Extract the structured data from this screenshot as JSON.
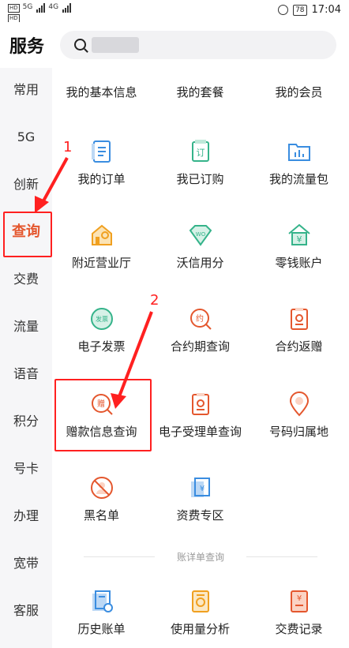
{
  "status_bar": {
    "left_badge_1": "HD",
    "left_badge_2": "HD",
    "net_1": "5G",
    "net_2": "4G",
    "battery": "78",
    "time": "17:04"
  },
  "header": {
    "title": "服务"
  },
  "sidebar": {
    "items": [
      {
        "label": "常用"
      },
      {
        "label": "5G"
      },
      {
        "label": "创新"
      },
      {
        "label": "查询"
      },
      {
        "label": "交费"
      },
      {
        "label": "流量"
      },
      {
        "label": "语音"
      },
      {
        "label": "积分"
      },
      {
        "label": "号卡"
      },
      {
        "label": "办理"
      },
      {
        "label": "宽带"
      },
      {
        "label": "客服"
      }
    ],
    "active_index": 3
  },
  "main": {
    "top_row": [
      "我的基本信息",
      "我的套餐",
      "我的会员"
    ],
    "grid": [
      {
        "label": "我的订单",
        "icon": "order-list-icon"
      },
      {
        "label": "我已订购",
        "icon": "subscribed-icon",
        "glyph": "订"
      },
      {
        "label": "我的流量包",
        "icon": "data-package-icon"
      },
      {
        "label": "附近营业厅",
        "icon": "nearby-store-icon"
      },
      {
        "label": "沃信用分",
        "icon": "credit-score-icon",
        "glyph": "WO"
      },
      {
        "label": "零钱账户",
        "icon": "wallet-account-icon",
        "glyph": "¥"
      },
      {
        "label": "电子发票",
        "icon": "e-invoice-icon",
        "glyph": "发票"
      },
      {
        "label": "合约期查询",
        "icon": "contract-period-icon",
        "glyph": "约"
      },
      {
        "label": "合约返赠",
        "icon": "contract-gift-icon"
      },
      {
        "label": "赠款信息查询",
        "icon": "gift-money-icon",
        "glyph": "赠"
      },
      {
        "label": "电子受理单查询",
        "icon": "e-receipt-icon"
      },
      {
        "label": "号码归属地",
        "icon": "number-location-icon"
      },
      {
        "label": "黑名单",
        "icon": "blacklist-icon"
      },
      {
        "label": "资费专区",
        "icon": "tariff-zone-icon",
        "glyph": "¥"
      }
    ],
    "section_title": "账详单查询",
    "bill_row": [
      {
        "label": "历史账单",
        "icon": "history-bill-icon"
      },
      {
        "label": "使用量分析",
        "icon": "usage-analysis-icon"
      },
      {
        "label": "交费记录",
        "icon": "payment-record-icon",
        "glyph": "¥"
      }
    ]
  },
  "annotations": {
    "step_1": "1",
    "step_2": "2"
  },
  "colors": {
    "accent": "#e4572e",
    "blue": "#3a8de0",
    "green": "#35b38a",
    "annotation": "#ff2020"
  }
}
